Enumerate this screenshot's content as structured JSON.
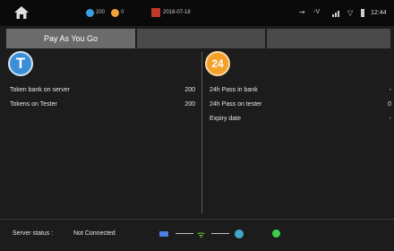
{
  "statusbar": {
    "tokens_count": "200",
    "passes_count": "0",
    "date": "2018-07-18",
    "voltage": "-V",
    "time": "12:44"
  },
  "tabs": [
    {
      "label": "Pay As You Go",
      "active": true
    },
    {
      "label": "",
      "active": false
    },
    {
      "label": "",
      "active": false
    }
  ],
  "left_panel": {
    "icon_letter": "T",
    "rows": [
      {
        "label": "Token bank on server",
        "value": "200"
      },
      {
        "label": "Tokens on Tester",
        "value": "200"
      }
    ]
  },
  "right_panel": {
    "icon_text": "24",
    "rows": [
      {
        "label": "24h Pass in bank",
        "value": "-"
      },
      {
        "label": "24h Pass on tester",
        "value": "0"
      },
      {
        "label": "Expiry date",
        "value": "-"
      }
    ]
  },
  "server": {
    "label": "Server status :",
    "value": "Not Connected"
  },
  "colors": {
    "token_blue": "#3b8fd6",
    "pass_orange": "#f3a12a",
    "status_green": "#3fcf4c"
  }
}
